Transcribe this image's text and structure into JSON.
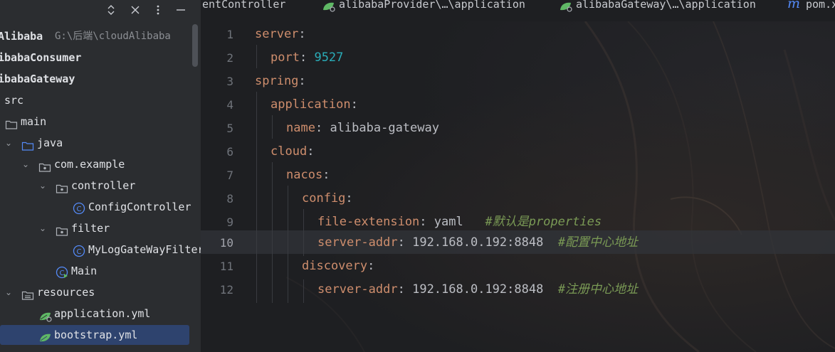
{
  "project_panel": {
    "toolbar": {
      "expand_collapse_icon": "⌃⌄",
      "close_icon": "✕",
      "more_icon": "⋮",
      "minimize_icon": "—"
    },
    "tree": [
      {
        "label": "Alibaba",
        "hint": "G:\\后端\\cloudAlibaba"
      },
      {
        "label": "ibabaConsumer"
      },
      {
        "label": "ibabaGateway"
      },
      {
        "label": "src"
      },
      {
        "label": "main"
      },
      {
        "label": "java"
      },
      {
        "label": "com.example"
      },
      {
        "label": "controller"
      },
      {
        "label": "ConfigController"
      },
      {
        "label": "filter"
      },
      {
        "label": "MyLogGateWayFilter"
      },
      {
        "label": "Main"
      },
      {
        "label": "resources"
      },
      {
        "label": "application.yml"
      },
      {
        "label": "bootstrap.yml"
      }
    ]
  },
  "tabs": [
    {
      "label": "entController"
    },
    {
      "label": "alibabaProvider\\…\\application"
    },
    {
      "label": "alibabaGateway\\…\\application"
    },
    {
      "label": "pom.x"
    }
  ],
  "editor": {
    "current_line": 10,
    "lines": [
      {
        "num": "1",
        "key": "server",
        "colon": ":",
        "value": "",
        "comment": ""
      },
      {
        "num": "2",
        "key": "port",
        "colon": ":",
        "value": "9527",
        "comment": ""
      },
      {
        "num": "3",
        "key": "spring",
        "colon": ":",
        "value": "",
        "comment": ""
      },
      {
        "num": "4",
        "key": "application",
        "colon": ":",
        "value": "",
        "comment": ""
      },
      {
        "num": "5",
        "key": "name",
        "colon": ":",
        "value": "alibaba-gateway",
        "comment": ""
      },
      {
        "num": "6",
        "key": "cloud",
        "colon": ":",
        "value": "",
        "comment": ""
      },
      {
        "num": "7",
        "key": "nacos",
        "colon": ":",
        "value": "",
        "comment": ""
      },
      {
        "num": "8",
        "key": "config",
        "colon": ":",
        "value": "",
        "comment": ""
      },
      {
        "num": "9",
        "key": "file-extension",
        "colon": ":",
        "value": "yaml",
        "comment": "#默认是properties"
      },
      {
        "num": "10",
        "key": "server-addr",
        "colon": ":",
        "value": "192.168.0.192:8848",
        "comment": "#配置中心地址"
      },
      {
        "num": "11",
        "key": "discovery",
        "colon": ":",
        "value": "",
        "comment": ""
      },
      {
        "num": "12",
        "key": "server-addr",
        "colon": ":",
        "value": "192.168.0.192:8848",
        "comment": "#注册中心地址"
      }
    ]
  },
  "colors": {
    "yaml_key": "#cf8e6d",
    "number": "#2aacb8",
    "comment": "#7a9a55",
    "selection": "#2e436e",
    "panel_bg": "#2b2d30",
    "editor_bg": "#1e1f22"
  }
}
